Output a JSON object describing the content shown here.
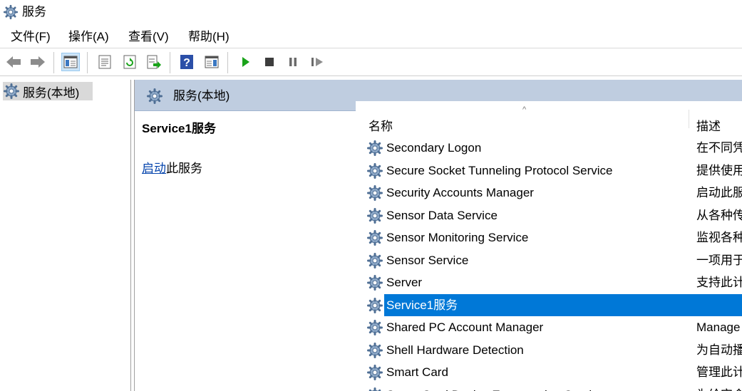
{
  "window": {
    "title": "服务",
    "icon": "gear-icon"
  },
  "menu": [
    "文件(F)",
    "操作(A)",
    "查看(V)",
    "帮助(H)"
  ],
  "toolbar": {
    "buttons": [
      "back-arrow-icon",
      "forward-arrow-icon",
      "console-tree-icon",
      "properties-icon",
      "refresh-icon",
      "export-list-icon",
      "help-icon",
      "show-pane-icon",
      "start-service-icon",
      "stop-service-icon",
      "pause-service-icon",
      "restart-service-icon"
    ]
  },
  "tree": {
    "root_label": "服务(本地)"
  },
  "pane": {
    "header": "服务(本地)",
    "detail_title": "Service1服务",
    "action_link": "启动",
    "action_rest": "此服务"
  },
  "list": {
    "columns": {
      "name": "名称",
      "description": "描述"
    },
    "sort_indicator": "^",
    "rows": [
      {
        "name": "Secondary Logon",
        "description": "在不同凭"
      },
      {
        "name": "Secure Socket Tunneling Protocol Service",
        "description": "提供使用"
      },
      {
        "name": "Security Accounts Manager",
        "description": "启动此服"
      },
      {
        "name": "Sensor Data Service",
        "description": "从各种传"
      },
      {
        "name": "Sensor Monitoring Service",
        "description": "监视各种"
      },
      {
        "name": "Sensor Service",
        "description": "一项用于"
      },
      {
        "name": "Server",
        "description": "支持此计"
      },
      {
        "name": "Service1服务",
        "description": "",
        "selected": true
      },
      {
        "name": "Shared PC Account Manager",
        "description": "Manage"
      },
      {
        "name": "Shell Hardware Detection",
        "description": "为自动播"
      },
      {
        "name": "Smart Card",
        "description": "管理此计"
      },
      {
        "name": "Smart Card Device Enumeration Service",
        "description": "为给定会"
      }
    ]
  },
  "colors": {
    "selection": "#0078d7",
    "header": "#bfcde0",
    "link": "#0645ad",
    "play": "#1aa31a"
  }
}
